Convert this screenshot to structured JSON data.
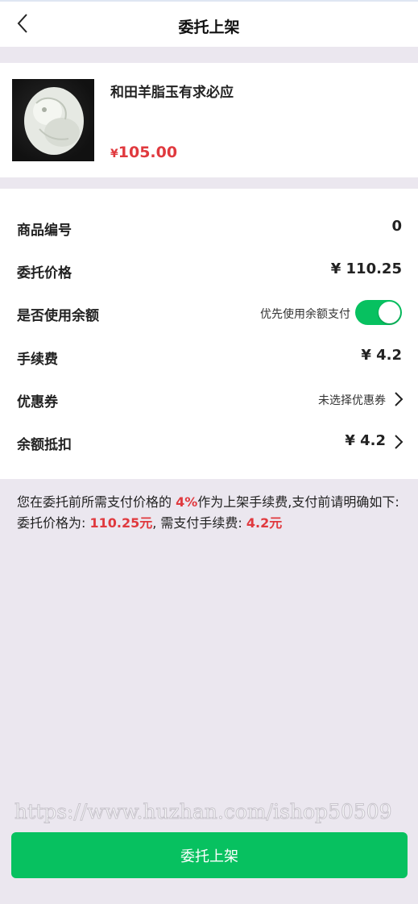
{
  "header": {
    "title": "委托上架"
  },
  "product": {
    "name": "和田羊脂玉有求必应",
    "price_currency": "¥",
    "price": "105.00"
  },
  "details": [
    {
      "label": "商品编号",
      "value": "0"
    },
    {
      "label": "委托价格",
      "value": "¥ 110.25"
    },
    {
      "label": "是否使用余额",
      "sub": "优先使用余额支付",
      "toggle_on": true
    },
    {
      "label": "手续费",
      "value": "¥ 4.2"
    },
    {
      "label": "优惠券",
      "sub": "未选择优惠券"
    },
    {
      "label": "余额抵扣",
      "value": "¥ 4.2"
    }
  ],
  "notice": {
    "p1": "您在委托前所需支付价格的 ",
    "rate": "4%",
    "p2": "作为上架手续费,支付前请明确如下:",
    "p3": "委托价格为: ",
    "price": "110.25元",
    "p4": ", 需支付手续费: ",
    "fee": "4.2元"
  },
  "watermark": "https://www.huzhan.com/ishop50509",
  "submit_label": "委托上架",
  "colors": {
    "accent": "#07c160",
    "price": "#e0393e",
    "background": "#ebe7ef"
  }
}
